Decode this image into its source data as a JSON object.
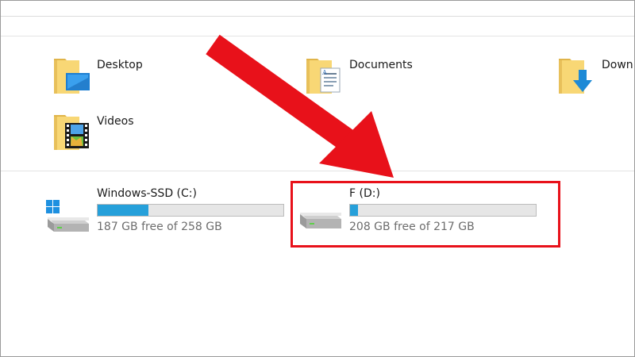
{
  "folders": [
    {
      "id": "desktop",
      "label": "Desktop",
      "icon": "desktop-folder-icon"
    },
    {
      "id": "documents",
      "label": "Documents",
      "icon": "documents-folder-icon"
    },
    {
      "id": "downloads",
      "label": "Down",
      "icon": "downloads-folder-icon"
    },
    {
      "id": "videos",
      "label": "Videos",
      "icon": "videos-folder-icon"
    }
  ],
  "drives": [
    {
      "name": "Windows-SSD (C:)",
      "free_text": "187 GB free of 258 GB",
      "used_fraction": 0.275,
      "icon": "windows-drive-icon"
    },
    {
      "name": "F (D:)",
      "free_text": "208 GB free of 217 GB",
      "used_fraction": 0.041,
      "icon": "hard-drive-icon"
    }
  ],
  "colors": {
    "bar_fill": "#26a0da",
    "bar_track": "#e6e6e6",
    "annotation_red": "#e8111a",
    "folder_yellow": "#f8d775"
  }
}
